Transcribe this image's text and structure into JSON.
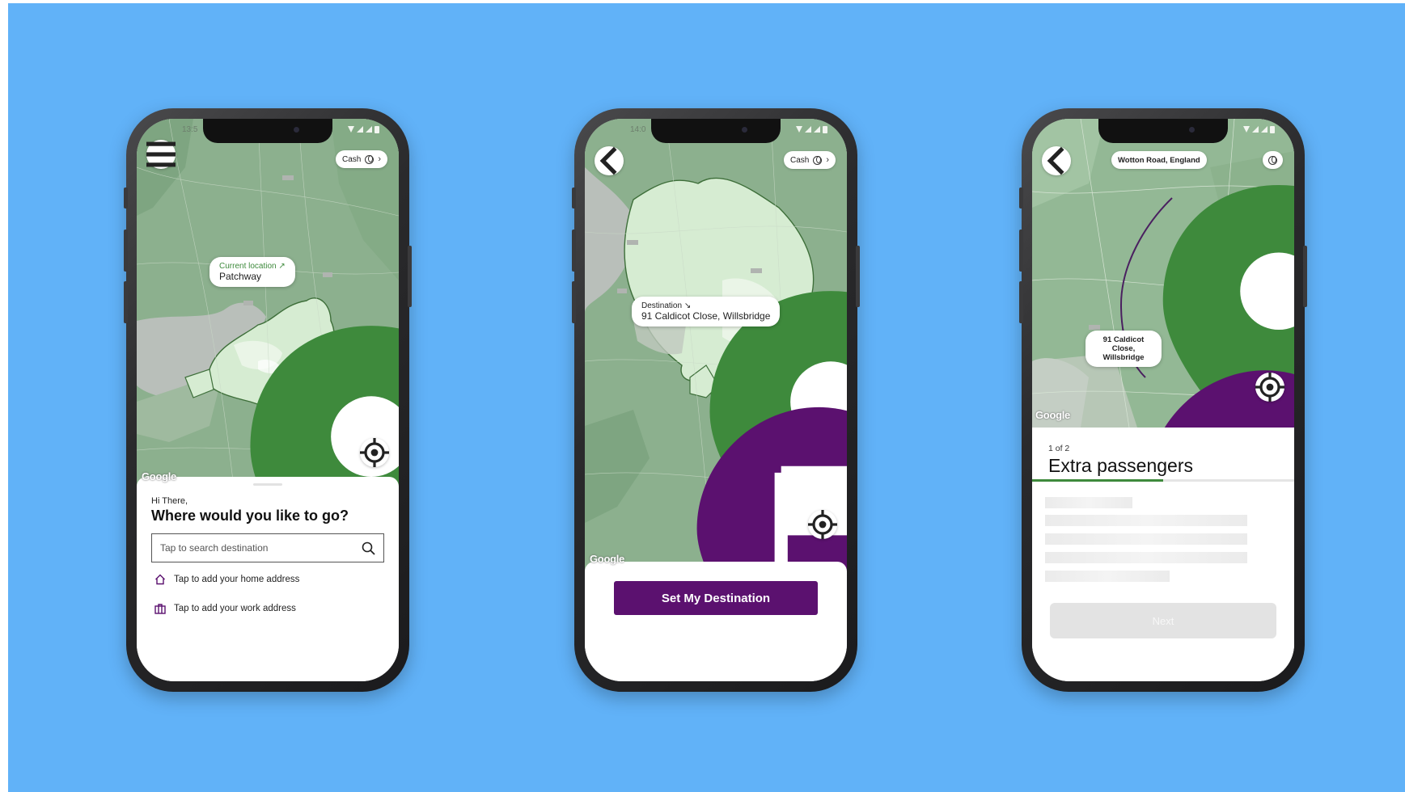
{
  "screens": {
    "home": {
      "status_time": "13:5",
      "payment_label": "Cash",
      "callout_label": "Current location",
      "callout_value": "Patchway",
      "greeting": "Hi There,",
      "headline": "Where would you like to go?",
      "search_placeholder": "Tap to search destination",
      "home_address": "Tap to add your home address",
      "work_address": "Tap to add your work address",
      "map_credit": "Google"
    },
    "destination": {
      "status_time": "14:0",
      "payment_label": "Cash",
      "callout_label": "Destination",
      "callout_value": "91 Caldicot Close, Willsbridge",
      "cta_label": "Set My Destination",
      "map_credit": "Google"
    },
    "passengers": {
      "pickup_label": "Wotton Road, England",
      "dropoff_label": "91 Caldicot Close, Willsbridge",
      "step_text": "1 of 2",
      "title": "Extra passengers",
      "progress": 0.5,
      "next_label": "Next",
      "map_credit": "Google"
    }
  },
  "colors": {
    "background": "#61b2f8",
    "brand_purple": "#5b116f",
    "brand_green": "#3e8a3c",
    "map_green": "#8aae8c",
    "zone_green": "#d6ecd2"
  }
}
